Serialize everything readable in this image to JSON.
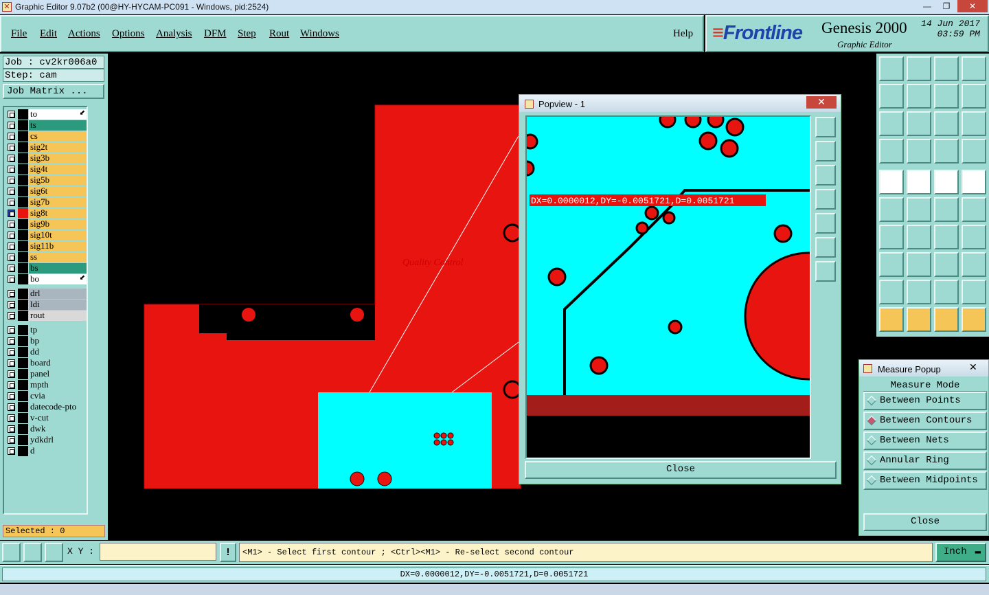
{
  "window": {
    "title": "Graphic Editor 9.07b2 (00@HY-HYCAM-PC091 - Windows, pid:2524)"
  },
  "menu": [
    "File",
    "Edit",
    "Actions",
    "Options",
    "Analysis",
    "DFM",
    "Step",
    "Rout",
    "Windows"
  ],
  "help": "Help",
  "brand": {
    "logo": "Frontline",
    "product": "Genesis 2000",
    "subtitle": "Graphic Editor",
    "date": "14 Jun 2017",
    "time": "03:59 PM"
  },
  "job": {
    "job_label": "Job : cv2kr006a0",
    "step_label": "Step: cam",
    "matrix_button": "Job Matrix ..."
  },
  "layers": [
    {
      "name": "to",
      "color": "#ffffff",
      "arrow": true
    },
    {
      "name": "ts",
      "color": "#2c9b7d"
    },
    {
      "name": "cs",
      "color": "#f5c657"
    },
    {
      "name": "sig2t",
      "color": "#f5c657"
    },
    {
      "name": "sig3b",
      "color": "#f5c657"
    },
    {
      "name": "sig4t",
      "color": "#f5c657"
    },
    {
      "name": "sig5b",
      "color": "#f5c657"
    },
    {
      "name": "sig6t",
      "color": "#f5c657"
    },
    {
      "name": "sig7b",
      "color": "#f5c657"
    },
    {
      "name": "sig8t",
      "color": "#f5c657",
      "active": true
    },
    {
      "name": "sig9b",
      "color": "#f5c657"
    },
    {
      "name": "sig10t",
      "color": "#f5c657"
    },
    {
      "name": "sig11b",
      "color": "#f5c657"
    },
    {
      "name": "ss",
      "color": "#f5c657"
    },
    {
      "name": "bs",
      "color": "#2c9b7d"
    },
    {
      "name": "bo",
      "color": "#ffffff",
      "arrow": true
    },
    {
      "name": "drl",
      "color": "#a9b6c0"
    },
    {
      "name": "ldi",
      "color": "#a9b6c0"
    },
    {
      "name": "rout",
      "color": "#d9d9d9"
    },
    {
      "name": "tp",
      "color": "#9ed9d2"
    },
    {
      "name": "bp",
      "color": "#9ed9d2"
    },
    {
      "name": "dd",
      "color": "#9ed9d2"
    },
    {
      "name": "board",
      "color": "#9ed9d2"
    },
    {
      "name": "panel",
      "color": "#9ed9d2"
    },
    {
      "name": "mpth",
      "color": "#9ed9d2"
    },
    {
      "name": "cvia",
      "color": "#9ed9d2"
    },
    {
      "name": "datecode-pto",
      "color": "#9ed9d2"
    },
    {
      "name": "v-cut",
      "color": "#9ed9d2"
    },
    {
      "name": "dwk",
      "color": "#9ed9d2"
    },
    {
      "name": "ydkdrl",
      "color": "#9ed9d2"
    },
    {
      "name": "d",
      "color": "#9ed9d2"
    }
  ],
  "selected": "Selected : 0",
  "popview": {
    "title": "Popview - 1",
    "measurement": "DX=0.0000012,DY=-0.0051721,D=0.0051721",
    "close": "Close"
  },
  "measure": {
    "title": "Measure Popup",
    "mode_label": "Measure Mode",
    "options": [
      {
        "label": "Between Points",
        "selected": false
      },
      {
        "label": "Between Contours",
        "selected": true
      },
      {
        "label": "Between Nets",
        "selected": false
      },
      {
        "label": "Annular Ring",
        "selected": false
      },
      {
        "label": "Between Midpoints",
        "selected": false
      }
    ],
    "close": "Close"
  },
  "bottom": {
    "xy_label": "X Y :",
    "xy_value": "",
    "warn": "!",
    "prompt": "<M1> - Select first contour ; <Ctrl><M1> - Re-select second contour",
    "unit": "Inch"
  },
  "status": "DX=0.0000012,DY=-0.0051721,D=0.0051721",
  "colors": {
    "panel": "#9ed9d2",
    "copper": "#e8140f",
    "cyan": "#00ffff"
  },
  "canvas_text": "Quality Control"
}
